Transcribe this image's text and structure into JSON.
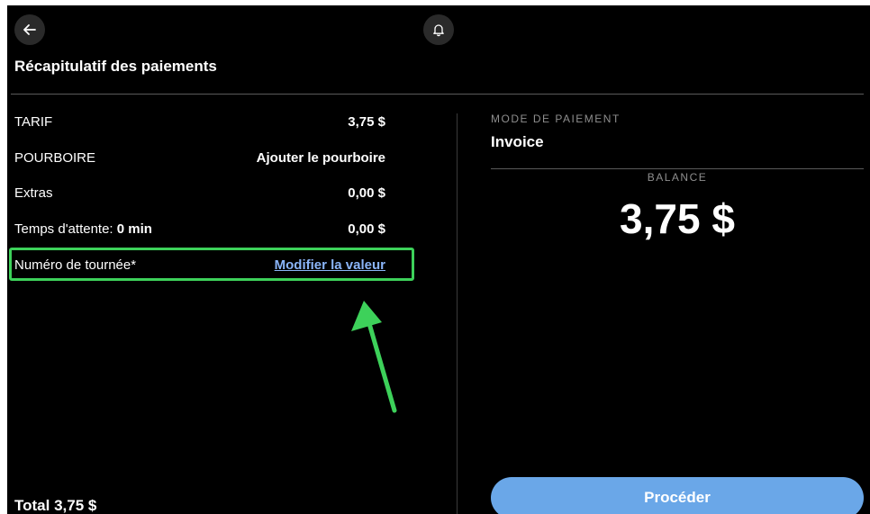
{
  "header": {
    "back_icon": "arrow-left-icon",
    "bell_icon": "bell-icon",
    "title": "Récapitulatif des paiements"
  },
  "summary": {
    "rows": [
      {
        "label": "TARIF",
        "value": "3,75 $"
      },
      {
        "label": "POURBOIRE",
        "value": "Ajouter le pourboire"
      },
      {
        "label": "Extras",
        "value": "0,00 $"
      },
      {
        "label": "Temps d'attente:",
        "label_bold": "0 min",
        "value": "0,00 $"
      },
      {
        "label": "Numéro de tournée*",
        "value": "Modifier la valeur"
      }
    ],
    "total_label": "Total",
    "total_value": "3,75 $"
  },
  "payment": {
    "mode_label": "MODE DE PAIEMENT",
    "mode_value": "Invoice",
    "balance_label": "BALANCE",
    "balance_amount": "3,75 $",
    "proceed_label": "Procéder"
  },
  "colors": {
    "background": "#000000",
    "accent_button": "#6aa7e8",
    "link": "#8ab4f8",
    "highlight": "#3dd15a"
  }
}
